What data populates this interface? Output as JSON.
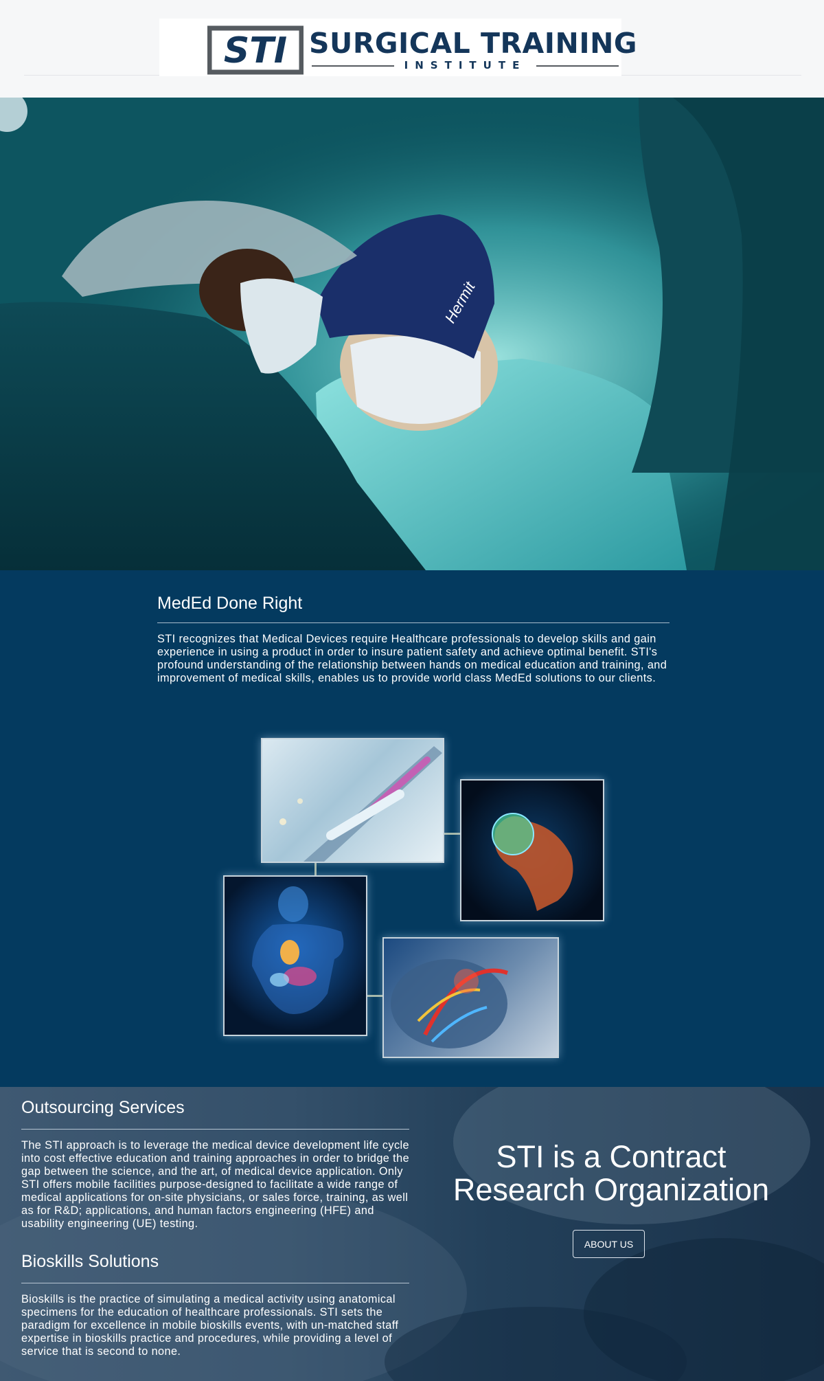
{
  "header": {
    "logo_mark": "STI",
    "logo_title": "SURGICAL TRAINING",
    "logo_subtitle": "INSTITUTE"
  },
  "hero": {
    "cap_text": "Hermit"
  },
  "meded": {
    "title": "MedEd Done Right",
    "body": "STI recognizes that Medical Devices require Healthcare professionals to develop skills and gain experience in using a product in order to insure patient safety and achieve optimal benefit. STI's profound understanding of the relationship between hands on medical education and training, and improvement of medical skills, enables us to provide world class MedEd solutions to our clients.",
    "images": [
      "catheter-device-image",
      "hip-bone-image",
      "human-anatomy-image",
      "heart-vessels-image"
    ]
  },
  "outsourcing": {
    "title": "Outsourcing Services",
    "body": "The STI approach is to leverage the medical device development life cycle into cost effective education and training approaches in order to bridge the gap between the science, and the art, of medical device application. Only STI offers mobile facilities purpose-designed to facilitate a wide range of medical applications for on-site physicians, or sales force, training, as well as for R&D; applications, and human factors engineering (HFE) and usability engineering (UE) testing."
  },
  "bioskills": {
    "title": "Bioskills Solutions",
    "body": "Bioskills is the practice of simulating a medical activity using anatomical specimens for the education of healthcare professionals. STI sets the paradigm for excellence in mobile bioskills events, with un-matched staff expertise in bioskills practice and procedures, while providing a level of service that is second to none."
  },
  "cro": {
    "heading_line1": "STI is a Contract",
    "heading_line2": "Research Organization",
    "button_label": "ABOUT US"
  },
  "colors": {
    "brand_navy": "#14365a",
    "section_blue": "#043a5f",
    "hero_teal": "#0b4c55"
  }
}
